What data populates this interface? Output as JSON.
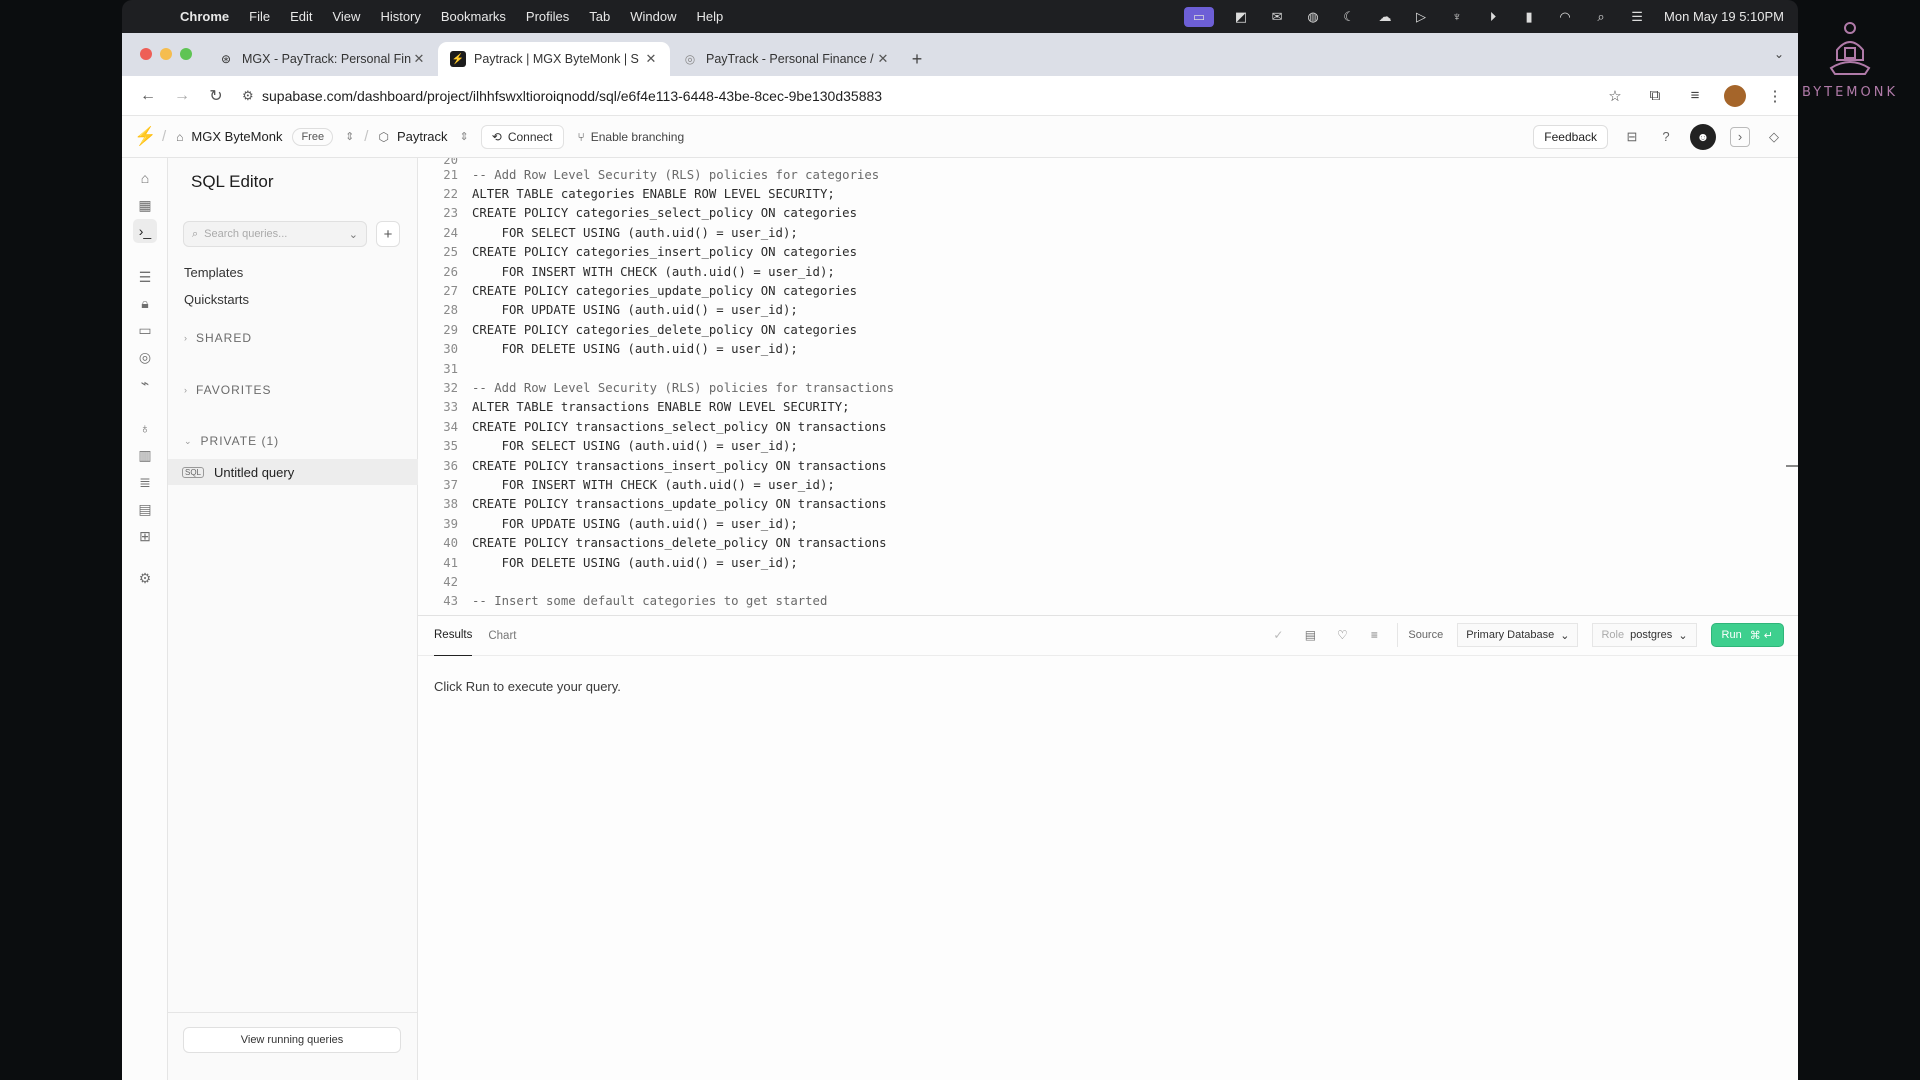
{
  "menubar": {
    "app_name": "Chrome",
    "items": [
      "File",
      "Edit",
      "View",
      "History",
      "Bookmarks",
      "Profiles",
      "Tab",
      "Window",
      "Help"
    ],
    "clock": "Mon May 19  5:10PM"
  },
  "browser": {
    "tabs": [
      {
        "title": "MGX - PayTrack: Personal Fin",
        "icon": "mgx-icon"
      },
      {
        "title": "Paytrack | MGX ByteMonk | S",
        "icon": "supabase-icon"
      },
      {
        "title": "PayTrack - Personal Finance /",
        "icon": "globe-icon"
      }
    ],
    "url": "supabase.com/dashboard/project/ilhhfswxltioroiqnodd/sql/e6f4e113-6448-43be-8cec-9be130d35883"
  },
  "header": {
    "org": "MGX ByteMonk",
    "plan_badge": "Free",
    "project": "Paytrack",
    "connect": "Connect",
    "branching": "Enable branching",
    "feedback": "Feedback"
  },
  "sidebar": {
    "title": "SQL Editor",
    "search_placeholder": "Search queries...",
    "links": [
      "Templates",
      "Quickstarts"
    ],
    "sections": [
      "SHARED",
      "FAVORITES",
      "PRIVATE (1)"
    ],
    "private_query": "Untitled query",
    "running_button": "View running queries"
  },
  "editor": {
    "lines": [
      {
        "n": "21",
        "t": "-- Add Row Level Security (RLS) policies for categories",
        "comment": true
      },
      {
        "n": "22",
        "t": "ALTER TABLE categories ENABLE ROW LEVEL SECURITY;"
      },
      {
        "n": "23",
        "t": "CREATE POLICY categories_select_policy ON categories"
      },
      {
        "n": "24",
        "t": "    FOR SELECT USING (auth.uid() = user_id);"
      },
      {
        "n": "25",
        "t": "CREATE POLICY categories_insert_policy ON categories"
      },
      {
        "n": "26",
        "t": "    FOR INSERT WITH CHECK (auth.uid() = user_id);"
      },
      {
        "n": "27",
        "t": "CREATE POLICY categories_update_policy ON categories"
      },
      {
        "n": "28",
        "t": "    FOR UPDATE USING (auth.uid() = user_id);"
      },
      {
        "n": "29",
        "t": "CREATE POLICY categories_delete_policy ON categories"
      },
      {
        "n": "30",
        "t": "    FOR DELETE USING (auth.uid() = user_id);"
      },
      {
        "n": "31",
        "t": ""
      },
      {
        "n": "32",
        "t": "-- Add Row Level Security (RLS) policies for transactions",
        "comment": true
      },
      {
        "n": "33",
        "t": "ALTER TABLE transactions ENABLE ROW LEVEL SECURITY;"
      },
      {
        "n": "34",
        "t": "CREATE POLICY transactions_select_policy ON transactions"
      },
      {
        "n": "35",
        "t": "    FOR SELECT USING (auth.uid() = user_id);"
      },
      {
        "n": "36",
        "t": "CREATE POLICY transactions_insert_policy ON transactions"
      },
      {
        "n": "37",
        "t": "    FOR INSERT WITH CHECK (auth.uid() = user_id);"
      },
      {
        "n": "38",
        "t": "CREATE POLICY transactions_update_policy ON transactions"
      },
      {
        "n": "39",
        "t": "    FOR UPDATE USING (auth.uid() = user_id);"
      },
      {
        "n": "40",
        "t": "CREATE POLICY transactions_delete_policy ON transactions"
      },
      {
        "n": "41",
        "t": "    FOR DELETE USING (auth.uid() = user_id);"
      },
      {
        "n": "42",
        "t": ""
      },
      {
        "n": "43",
        "t": "-- Insert some default categories to get started",
        "comment": true
      }
    ]
  },
  "results": {
    "tabs": [
      "Results",
      "Chart"
    ],
    "source_label": "Source",
    "database": "Primary Database",
    "role_label": "Role",
    "role": "postgres",
    "run_label": "Run",
    "run_shortcut": "⌘ ↵",
    "empty_message": "Click Run to execute your query."
  },
  "watermark": "BYTEMONK",
  "colors": {
    "supabase_green": "#3ecf8e",
    "active_menu_icon": "#6d5fd6"
  }
}
